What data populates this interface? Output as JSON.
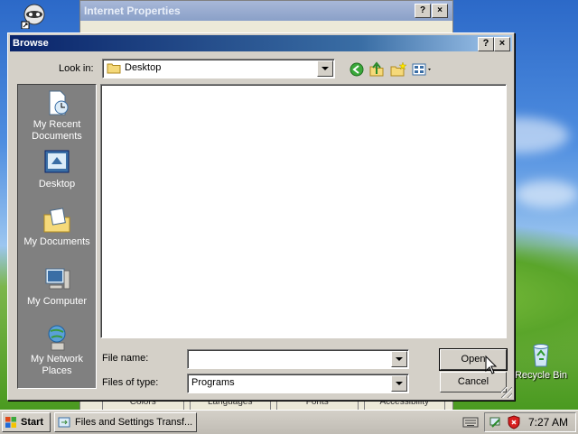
{
  "desktop": {
    "icons": [
      {
        "label": "Recycle Bin",
        "icon": "recycle-bin-icon"
      }
    ]
  },
  "background_window": {
    "title": "Internet Properties",
    "help_label": "?",
    "close_label": "×",
    "buttons": [
      "Colors",
      "Languages",
      "Fonts",
      "Accessibility"
    ]
  },
  "dialog": {
    "title": "Browse",
    "help_label": "?",
    "close_label": "×",
    "look_in_label": "Look in:",
    "look_in_value": "Desktop",
    "places": [
      {
        "label": "My Recent Documents",
        "icon": "recent-documents-icon"
      },
      {
        "label": "Desktop",
        "icon": "desktop-icon"
      },
      {
        "label": "My Documents",
        "icon": "my-documents-icon"
      },
      {
        "label": "My Computer",
        "icon": "my-computer-icon"
      },
      {
        "label": "My Network Places",
        "icon": "network-places-icon"
      }
    ],
    "file_name_label": "File name:",
    "file_name_value": "",
    "file_type_label": "Files of type:",
    "file_type_value": "Programs",
    "open_label": "Open",
    "cancel_label": "Cancel"
  },
  "taskbar": {
    "start_label": "Start",
    "task_label": "Files and Settings Transf...",
    "clock": "7:27 AM"
  }
}
